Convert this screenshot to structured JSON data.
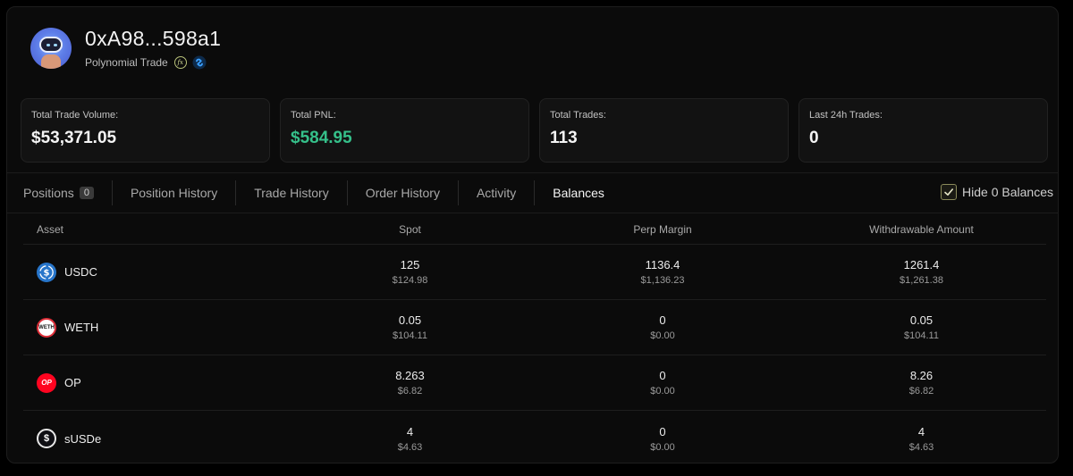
{
  "header": {
    "address": "0xA98...598a1",
    "platform": "Polynomial Trade",
    "fx_badge": "fx"
  },
  "stats": [
    {
      "label": "Total Trade Volume:",
      "value": "$53,371.05"
    },
    {
      "label": "Total PNL:",
      "value": "$584.95",
      "color": "#35c08a"
    },
    {
      "label": "Total Trades:",
      "value": "113"
    },
    {
      "label": "Last 24h Trades:",
      "value": "0"
    }
  ],
  "tabs": {
    "positions": "Positions",
    "positions_count": "0",
    "position_history": "Position History",
    "trade_history": "Trade History",
    "order_history": "Order History",
    "activity": "Activity",
    "balances": "Balances",
    "active": "Balances"
  },
  "hide_zero": {
    "label": "Hide 0 Balances",
    "checked": true
  },
  "table": {
    "headers": {
      "asset": "Asset",
      "spot": "Spot",
      "perp": "Perp Margin",
      "withdrawable": "Withdrawable Amount"
    },
    "rows": [
      {
        "asset": "USDC",
        "icon": "usdc-icon",
        "spot": "125",
        "spot_usd": "$124.98",
        "perp": "1136.4",
        "perp_usd": "$1,136.23",
        "wd": "1261.4",
        "wd_usd": "$1,261.38"
      },
      {
        "asset": "WETH",
        "icon": "weth-icon",
        "icon_text": "WETH",
        "spot": "0.05",
        "spot_usd": "$104.11",
        "perp": "0",
        "perp_usd": "$0.00",
        "wd": "0.05",
        "wd_usd": "$104.11"
      },
      {
        "asset": "OP",
        "icon": "op-icon",
        "icon_text": "OP",
        "spot": "8.263",
        "spot_usd": "$6.82",
        "perp": "0",
        "perp_usd": "$0.00",
        "wd": "8.26",
        "wd_usd": "$6.82"
      },
      {
        "asset": "sUSDe",
        "icon": "susde-icon",
        "icon_text": "$",
        "spot": "4",
        "spot_usd": "$4.63",
        "perp": "0",
        "perp_usd": "$0.00",
        "wd": "4",
        "wd_usd": "$4.63"
      }
    ]
  }
}
